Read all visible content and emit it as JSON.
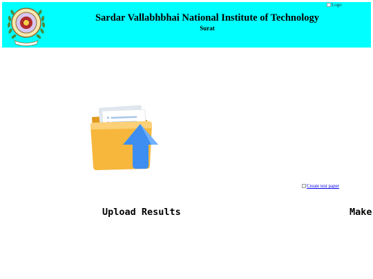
{
  "header": {
    "institute_name": "Sardar Vallabhbhai National Institute of Technology",
    "city": "Surat",
    "logo_alt": "Logo",
    "crest_icon": "svnit-crest-emblem",
    "background": "#00ffff"
  },
  "cards": {
    "upload": {
      "icon": "folder-upload-icon",
      "caption": "Upload Results"
    },
    "create": {
      "image_alt": "Create test paper",
      "caption": "Make"
    }
  },
  "colors": {
    "header_bg": "#00ffff",
    "link": "#0000ee",
    "folder": "#f4b23a",
    "arrow": "#3d8ef0"
  }
}
